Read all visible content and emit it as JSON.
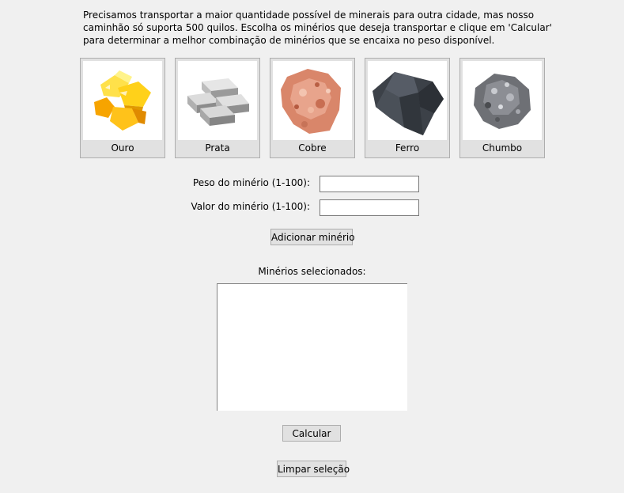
{
  "intro_text": "Precisamos transportar a maior quantidade possível de minerais para outra cidade, mas nosso caminhão só suporta 500 quilos. Escolha os minérios que deseja transportar e clique em 'Calcular' para determinar a melhor combinação de minérios que se encaixa no peso disponível.",
  "minerals": [
    {
      "name": "Ouro",
      "icon": "gold-nuggets-icon"
    },
    {
      "name": "Prata",
      "icon": "silver-bars-icon"
    },
    {
      "name": "Cobre",
      "icon": "copper-ore-icon"
    },
    {
      "name": "Ferro",
      "icon": "iron-ore-icon"
    },
    {
      "name": "Chumbo",
      "icon": "lead-ore-icon"
    }
  ],
  "form": {
    "weight_label": "Peso do minério (1-100):",
    "weight_value": "",
    "value_label": "Valor do minério (1-100):",
    "value_value": "",
    "add_button": "Adicionar minério"
  },
  "selected": {
    "label": "Minérios selecionados:",
    "items": []
  },
  "actions": {
    "calculate": "Calcular",
    "clear": "Limpar seleção"
  }
}
